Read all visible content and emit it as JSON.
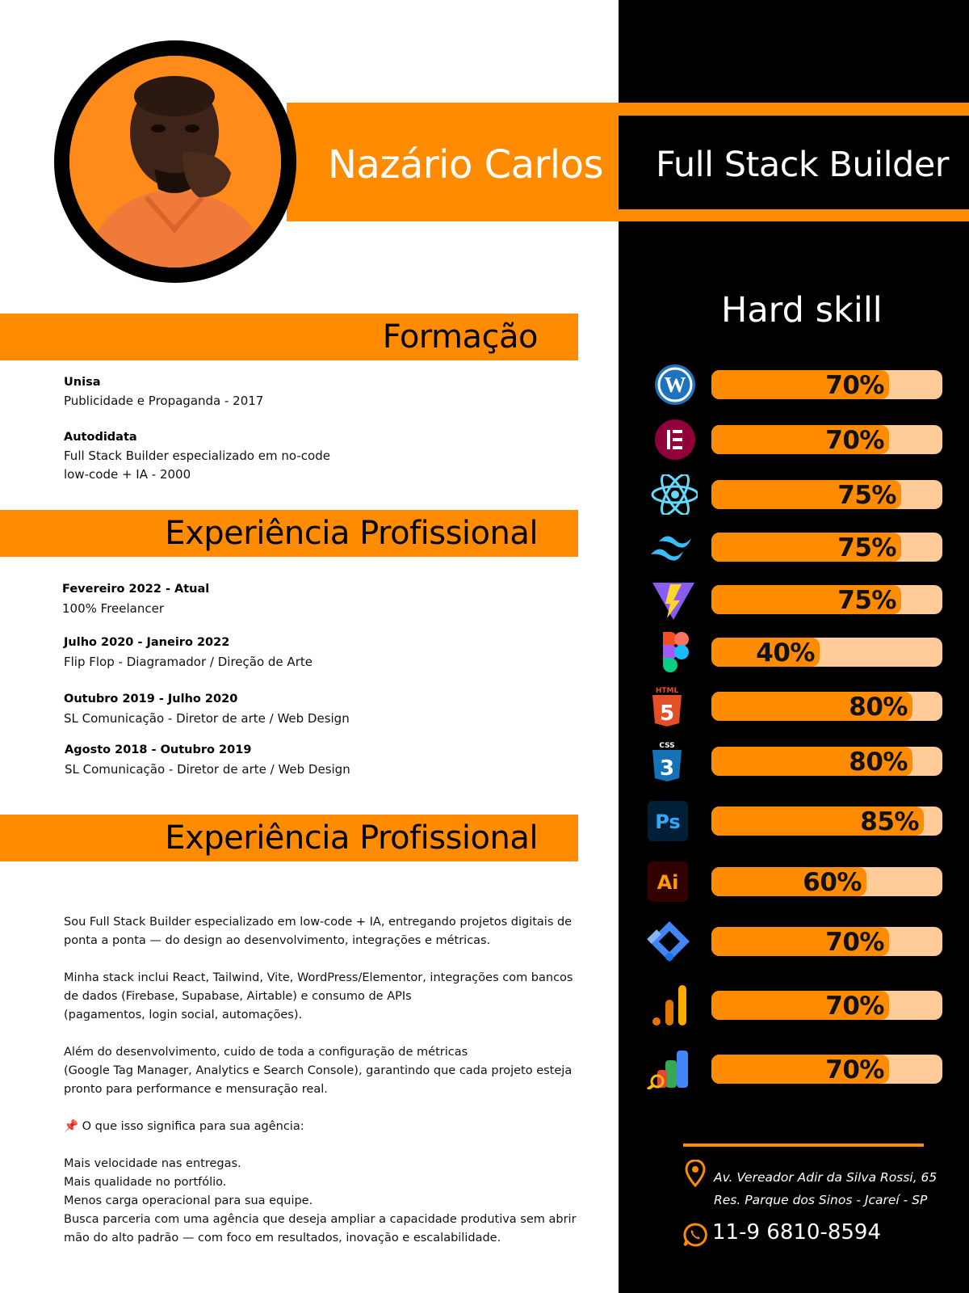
{
  "header": {
    "name": "Nazário Carlos",
    "role": "Full Stack Builder"
  },
  "formacao": {
    "title": "Formação",
    "items": [
      {
        "title": "Unisa",
        "lines": [
          "Publicidade e Propaganda - 2017"
        ]
      },
      {
        "title": "Autodidata",
        "lines": [
          "Full Stack Builder especializado em no-code",
          "low-code + IA - 2000"
        ]
      }
    ]
  },
  "experiencia": {
    "title": "Experiência Profissional",
    "items": [
      {
        "title": "Fevereiro 2022 - Atual",
        "line": "100% Freelancer"
      },
      {
        "title": "Julho 2020 - Janeiro 2022",
        "line": "Flip Flop - Diagramador / Direção de Arte"
      },
      {
        "title": "Outubro 2019 - Julho 2020",
        "line": "SL Comunicação - Diretor de arte / Web Design"
      },
      {
        "title": "Agosto 2018 - Outubro 2019",
        "line": "SL Comunicação - Diretor de arte / Web Design"
      }
    ]
  },
  "sobre": {
    "title": "Experiência Profissional",
    "lines": [
      "Sou Full Stack Builder especializado em low-code + IA, entregando projetos digitais de",
      "ponta a ponta — do design ao desenvolvimento, integrações e métricas.",
      "",
      "Minha stack inclui React, Tailwind, Vite, WordPress/Elementor, integrações com bancos",
      "de dados (Firebase, Supabase, Airtable) e consumo de APIs",
      "(pagamentos, login social, automações).",
      "",
      "Além do desenvolvimento, cuido de toda a configuração de métricas",
      "(Google Tag Manager, Analytics e Search Console), garantindo que cada projeto esteja",
      "pronto para performance e mensuração real.",
      "",
      "📌 O que isso significa para sua agência:",
      "",
      "Mais velocidade nas entregas.",
      "Mais qualidade no portfólio.",
      "Menos carga operacional para sua equipe.",
      "Busca parceria com uma agência que deseja ampliar a capacidade produtiva sem abrir",
      "mão do alto padrão — com foco em resultados, inovação e escalabilidade."
    ]
  },
  "hard_skill": {
    "title": "Hard skill",
    "skills": [
      {
        "icon": "wordpress-icon",
        "value": 70,
        "label": "70%"
      },
      {
        "icon": "elementor-icon",
        "value": 70,
        "label": "70%"
      },
      {
        "icon": "react-icon",
        "value": 75,
        "label": "75%"
      },
      {
        "icon": "tailwind-icon",
        "value": 75,
        "label": "75%"
      },
      {
        "icon": "vite-icon",
        "value": 75,
        "label": "75%"
      },
      {
        "icon": "figma-icon",
        "value": 40,
        "label": "40%"
      },
      {
        "icon": "html5-icon",
        "value": 80,
        "label": "80%"
      },
      {
        "icon": "css3-icon",
        "value": 80,
        "label": "80%"
      },
      {
        "icon": "photoshop-icon",
        "value": 85,
        "label": "85%"
      },
      {
        "icon": "illustrator-icon",
        "value": 60,
        "label": "60%"
      },
      {
        "icon": "google-tag-manager-icon",
        "value": 70,
        "label": "70%"
      },
      {
        "icon": "google-analytics-icon",
        "value": 70,
        "label": "70%"
      },
      {
        "icon": "google-search-console-icon",
        "value": 70,
        "label": "70%"
      }
    ]
  },
  "contact": {
    "address_line1": "Av. Vereador Adir da Silva Rossi, 65",
    "address_line2": "Res. Parque dos Sinos - Jcareí - SP",
    "phone": "11-9 6810-8594",
    "icons": [
      "location-pin-icon",
      "whatsapp-icon"
    ]
  },
  "colors": {
    "accent": "#ff8c00",
    "bar_track": "#ffcc99",
    "dark": "#000000"
  }
}
